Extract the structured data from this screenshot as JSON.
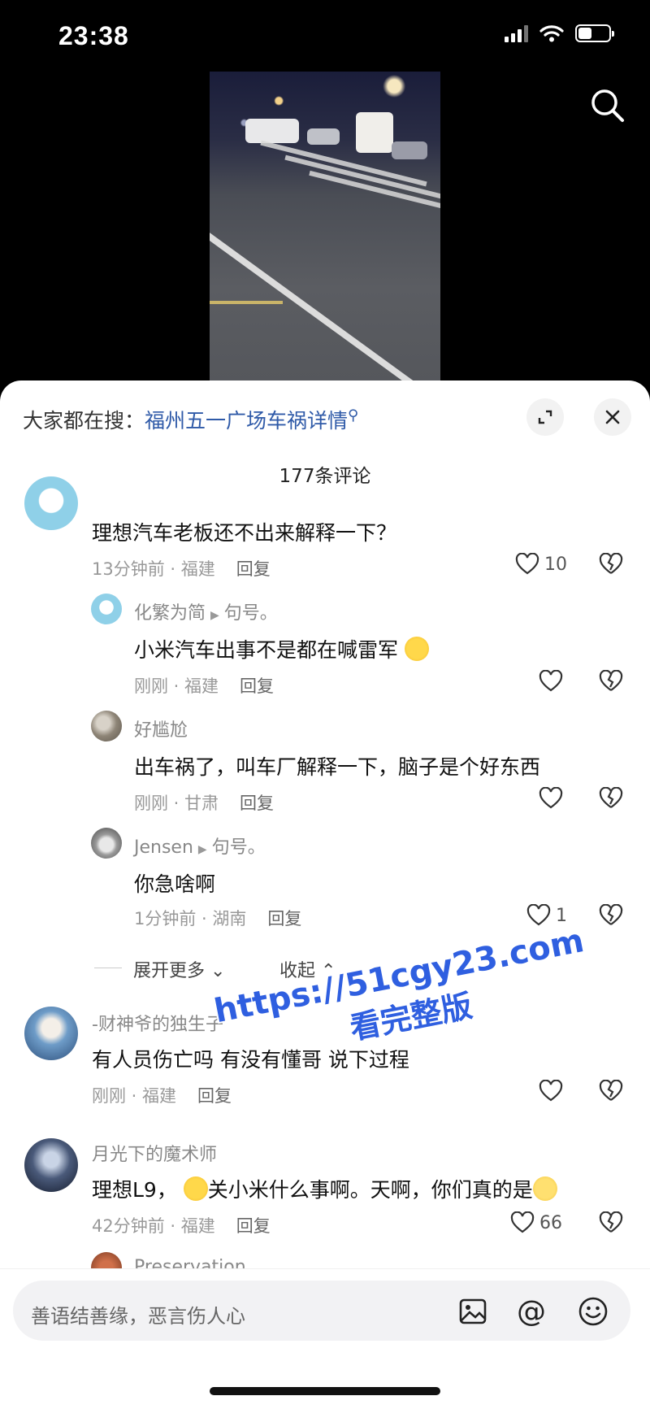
{
  "status_bar": {
    "time": "23:38",
    "battery_level": 0.45
  },
  "header": {
    "trending_prefix": "大家都在搜：",
    "trending_query": "福州五一广场车祸详情",
    "comment_count": "177条评论"
  },
  "comments": [
    {
      "username": "",
      "text": "理想汽车老板还不出来解释一下？",
      "time": "13分钟前 · 福建",
      "reply_label": "回复",
      "likes": "10"
    },
    {
      "username": "化繁为简",
      "reply_to": "句号。",
      "text": "小米汽车出事不是都在喊雷军",
      "time": "刚刚 · 福建",
      "reply_label": "回复",
      "likes": ""
    },
    {
      "username": "好尴尬",
      "text": "出车祸了，叫车厂解释一下，脑子是个好东西",
      "time": "刚刚 · 甘肃",
      "reply_label": "回复",
      "likes": ""
    },
    {
      "username": "Jensen",
      "reply_to": "句号。",
      "text": "你急啥啊",
      "time": "1分钟前 · 湖南",
      "reply_label": "回复",
      "likes": "1"
    },
    {
      "username": "-财神爷的独生子",
      "text": "有人员伤亡吗 有没有懂哥 说下过程",
      "time": "刚刚 · 福建",
      "reply_label": "回复",
      "likes": ""
    },
    {
      "username": "月光下的魔术师",
      "text_part1": "理想L9，",
      "text_part2": "关小米什么事啊。天啊，你们真的是",
      "time": "42分钟前 · 福建",
      "reply_label": "回复",
      "likes": "66"
    },
    {
      "username": "Preservation"
    }
  ],
  "thread_controls": {
    "expand_more": "展开更多",
    "collapse": "收起"
  },
  "watermark": {
    "url": "https://51cgy23.com",
    "sub": "看完整版"
  },
  "input_bar": {
    "placeholder": "善语结善缘，恶言伤人心"
  },
  "icons": {
    "search": "search-icon",
    "expand": "expand-icon",
    "close": "close-icon",
    "like": "heart-icon",
    "dislike": "broken-heart-icon",
    "image": "image-icon",
    "mention": "at-icon",
    "emoji": "emoji-icon"
  },
  "colors": {
    "link_blue": "#2f5aa8",
    "watermark_blue": "#2f5fe0"
  }
}
